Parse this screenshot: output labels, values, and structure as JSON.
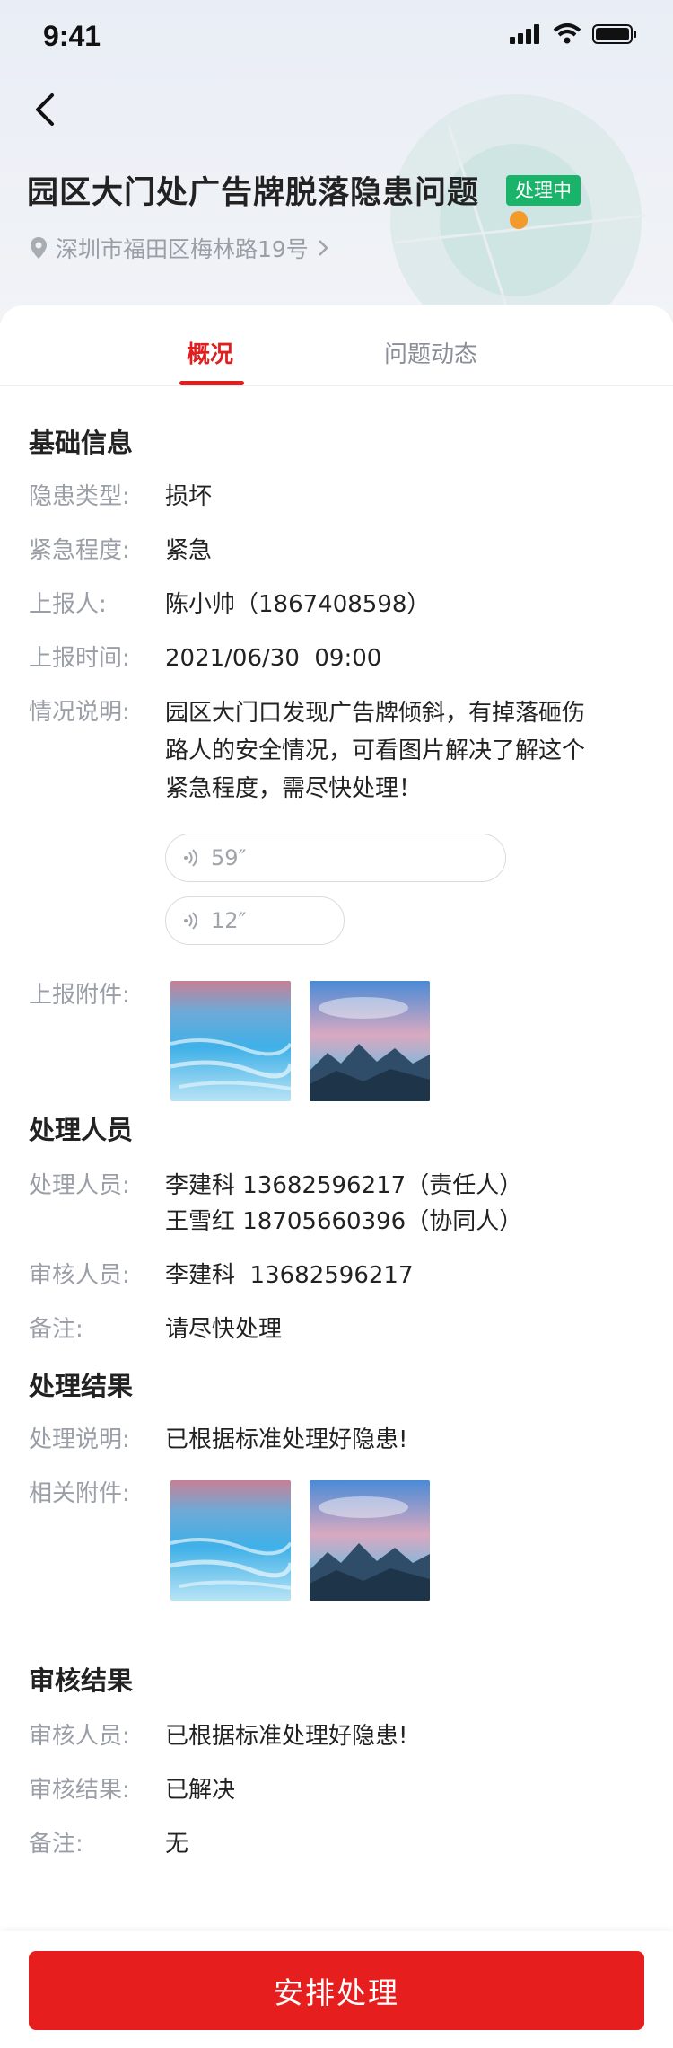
{
  "status_bar": {
    "time": "9:41"
  },
  "header": {
    "title": "园区大门处广告牌脱落隐患问题",
    "status_badge": "处理中",
    "location": "深圳市福田区梅林路19号"
  },
  "tabs": [
    {
      "label": "概况",
      "active": true
    },
    {
      "label": "问题动态",
      "active": false
    }
  ],
  "basic_info": {
    "section_title": "基础信息",
    "hazard_type_label": "隐患类型:",
    "hazard_type": "损坏",
    "urgency_label": "紧急程度:",
    "urgency": "紧急",
    "reporter_label": "上报人:",
    "reporter": "陈小帅（1867408598）",
    "report_time_label": "上报时间:",
    "report_time": "2021/06/30  09:00",
    "description_label": "情况说明:",
    "description_lines": [
      "园区大门口发现广告牌倾斜，有掉落砸伤",
      "路人的安全情况，可看图片解决了解这个",
      "紧急程度，需尽快处理！"
    ],
    "voice_1": "59″",
    "voice_2": "12″",
    "attachments_label": "上报附件:"
  },
  "handlers": {
    "section_title": "处理人员",
    "handler_label": "处理人员:",
    "handler_1": "李建科 13682596217（责任人）",
    "handler_2": "王雪红 18705660396（协同人）",
    "reviewer_label": "审核人员:",
    "reviewer": "李建科  13682596217",
    "note_label": "备注:",
    "note": "请尽快处理"
  },
  "result": {
    "section_title": "处理结果",
    "desc_label": "处理说明:",
    "desc": "已根据标准处理好隐患!",
    "attachments_label": "相关附件:"
  },
  "review": {
    "section_title": "审核结果",
    "reviewer_label": "审核人员:",
    "reviewer": "已根据标准处理好隐患!",
    "result_label": "审核结果:",
    "result": "已解决",
    "note_label": "备注:",
    "note": "无"
  },
  "footer": {
    "button_label": "安排处理"
  },
  "colors": {
    "accent": "#e01e1e",
    "badge": "#19b36a",
    "button": "#e61e1e"
  }
}
